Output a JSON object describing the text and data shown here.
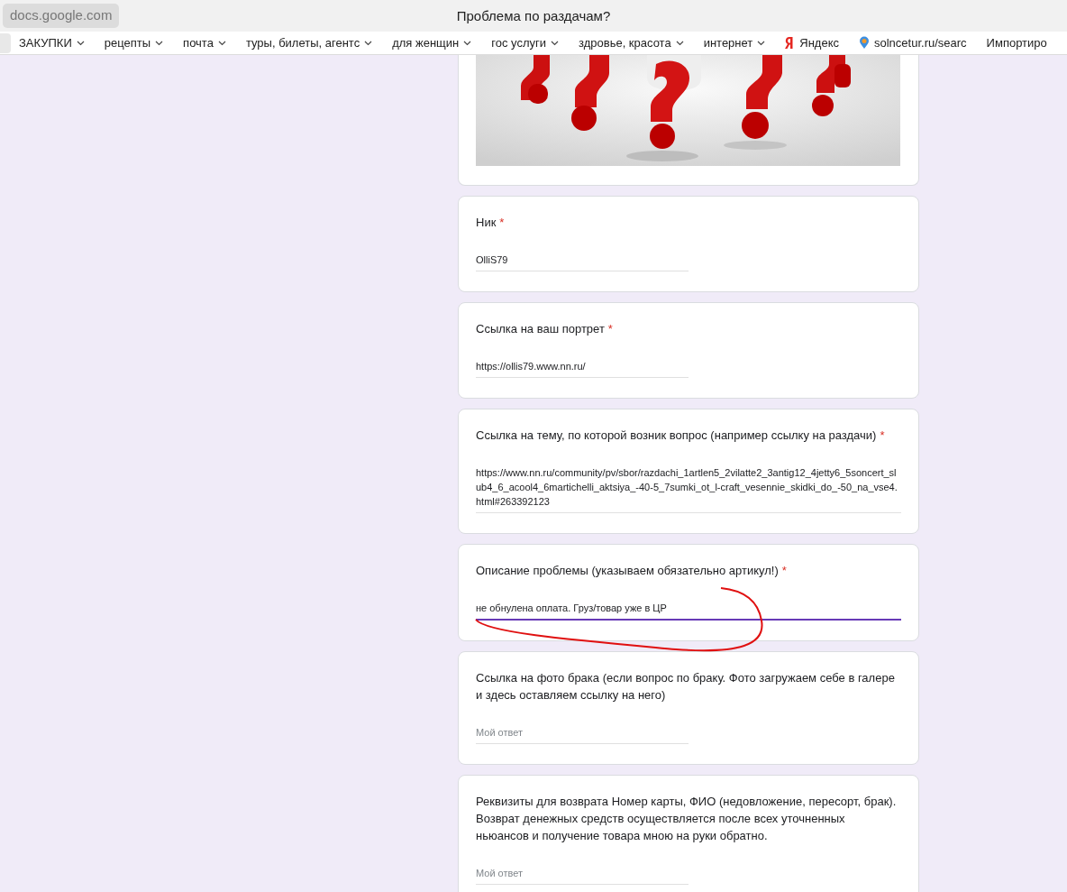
{
  "browser": {
    "address": "docs.google.com",
    "title": "Проблема по раздачам?"
  },
  "bookmarks": [
    {
      "kind": "folder",
      "label": "ЗАКУПКИ"
    },
    {
      "kind": "folder",
      "label": "рецепты"
    },
    {
      "kind": "folder",
      "label": "почта"
    },
    {
      "kind": "folder",
      "label": "туры, билеты, агентс"
    },
    {
      "kind": "folder",
      "label": "для женщин"
    },
    {
      "kind": "folder",
      "label": "гос услуги"
    },
    {
      "kind": "folder",
      "label": "здровье, красота"
    },
    {
      "kind": "folder",
      "label": "интернет"
    },
    {
      "kind": "yandex",
      "label": "Яндекс"
    },
    {
      "kind": "pin",
      "label": "solncetur.ru/searc"
    },
    {
      "kind": "plain",
      "label": "Импортиро"
    }
  ],
  "form": {
    "questions": [
      {
        "title": "Ник",
        "required_mark": "*",
        "value": "OlliS79",
        "wide": false,
        "focused": false
      },
      {
        "title": "Ссылка на ваш портрет",
        "required_mark": "*",
        "value": "https://ollis79.www.nn.ru/",
        "wide": false,
        "focused": false
      },
      {
        "title": "Ссылка на тему, по которой возник вопрос (например ссылку на раздачи)",
        "required_mark": "*",
        "value": "https://www.nn.ru/community/pv/sbor/razdachi_1artlen5_2vilatte2_3antig12_4jetty6_5soncert_slub4_6_acool4_6martichelli_aktsiya_-40-5_7sumki_ot_l-craft_vesennie_skidki_do_-50_na_vse4.html#263392123",
        "wide": true,
        "focused": false
      },
      {
        "title": "Описание проблемы (указываем обязательно артикул!)",
        "required_mark": "*",
        "value": "не обнулена оплата. Груз/товар уже в ЦР",
        "wide": true,
        "focused": true
      },
      {
        "title": "Ссылка на фото брака (если вопрос по браку. Фото загружаем себе в галере и здесь оставляем ссылку на него)",
        "placeholder": "Мой ответ",
        "wide": false,
        "focused": false
      },
      {
        "title": "Реквизиты для возврата Номер карты, ФИО (недовложение, пересорт, брак). Возврат денежных средств осуществляется после всех уточненных ньюансов и получение товара мною на руки обратно.",
        "placeholder": "Мой ответ",
        "wide": false,
        "focused": false
      }
    ]
  }
}
